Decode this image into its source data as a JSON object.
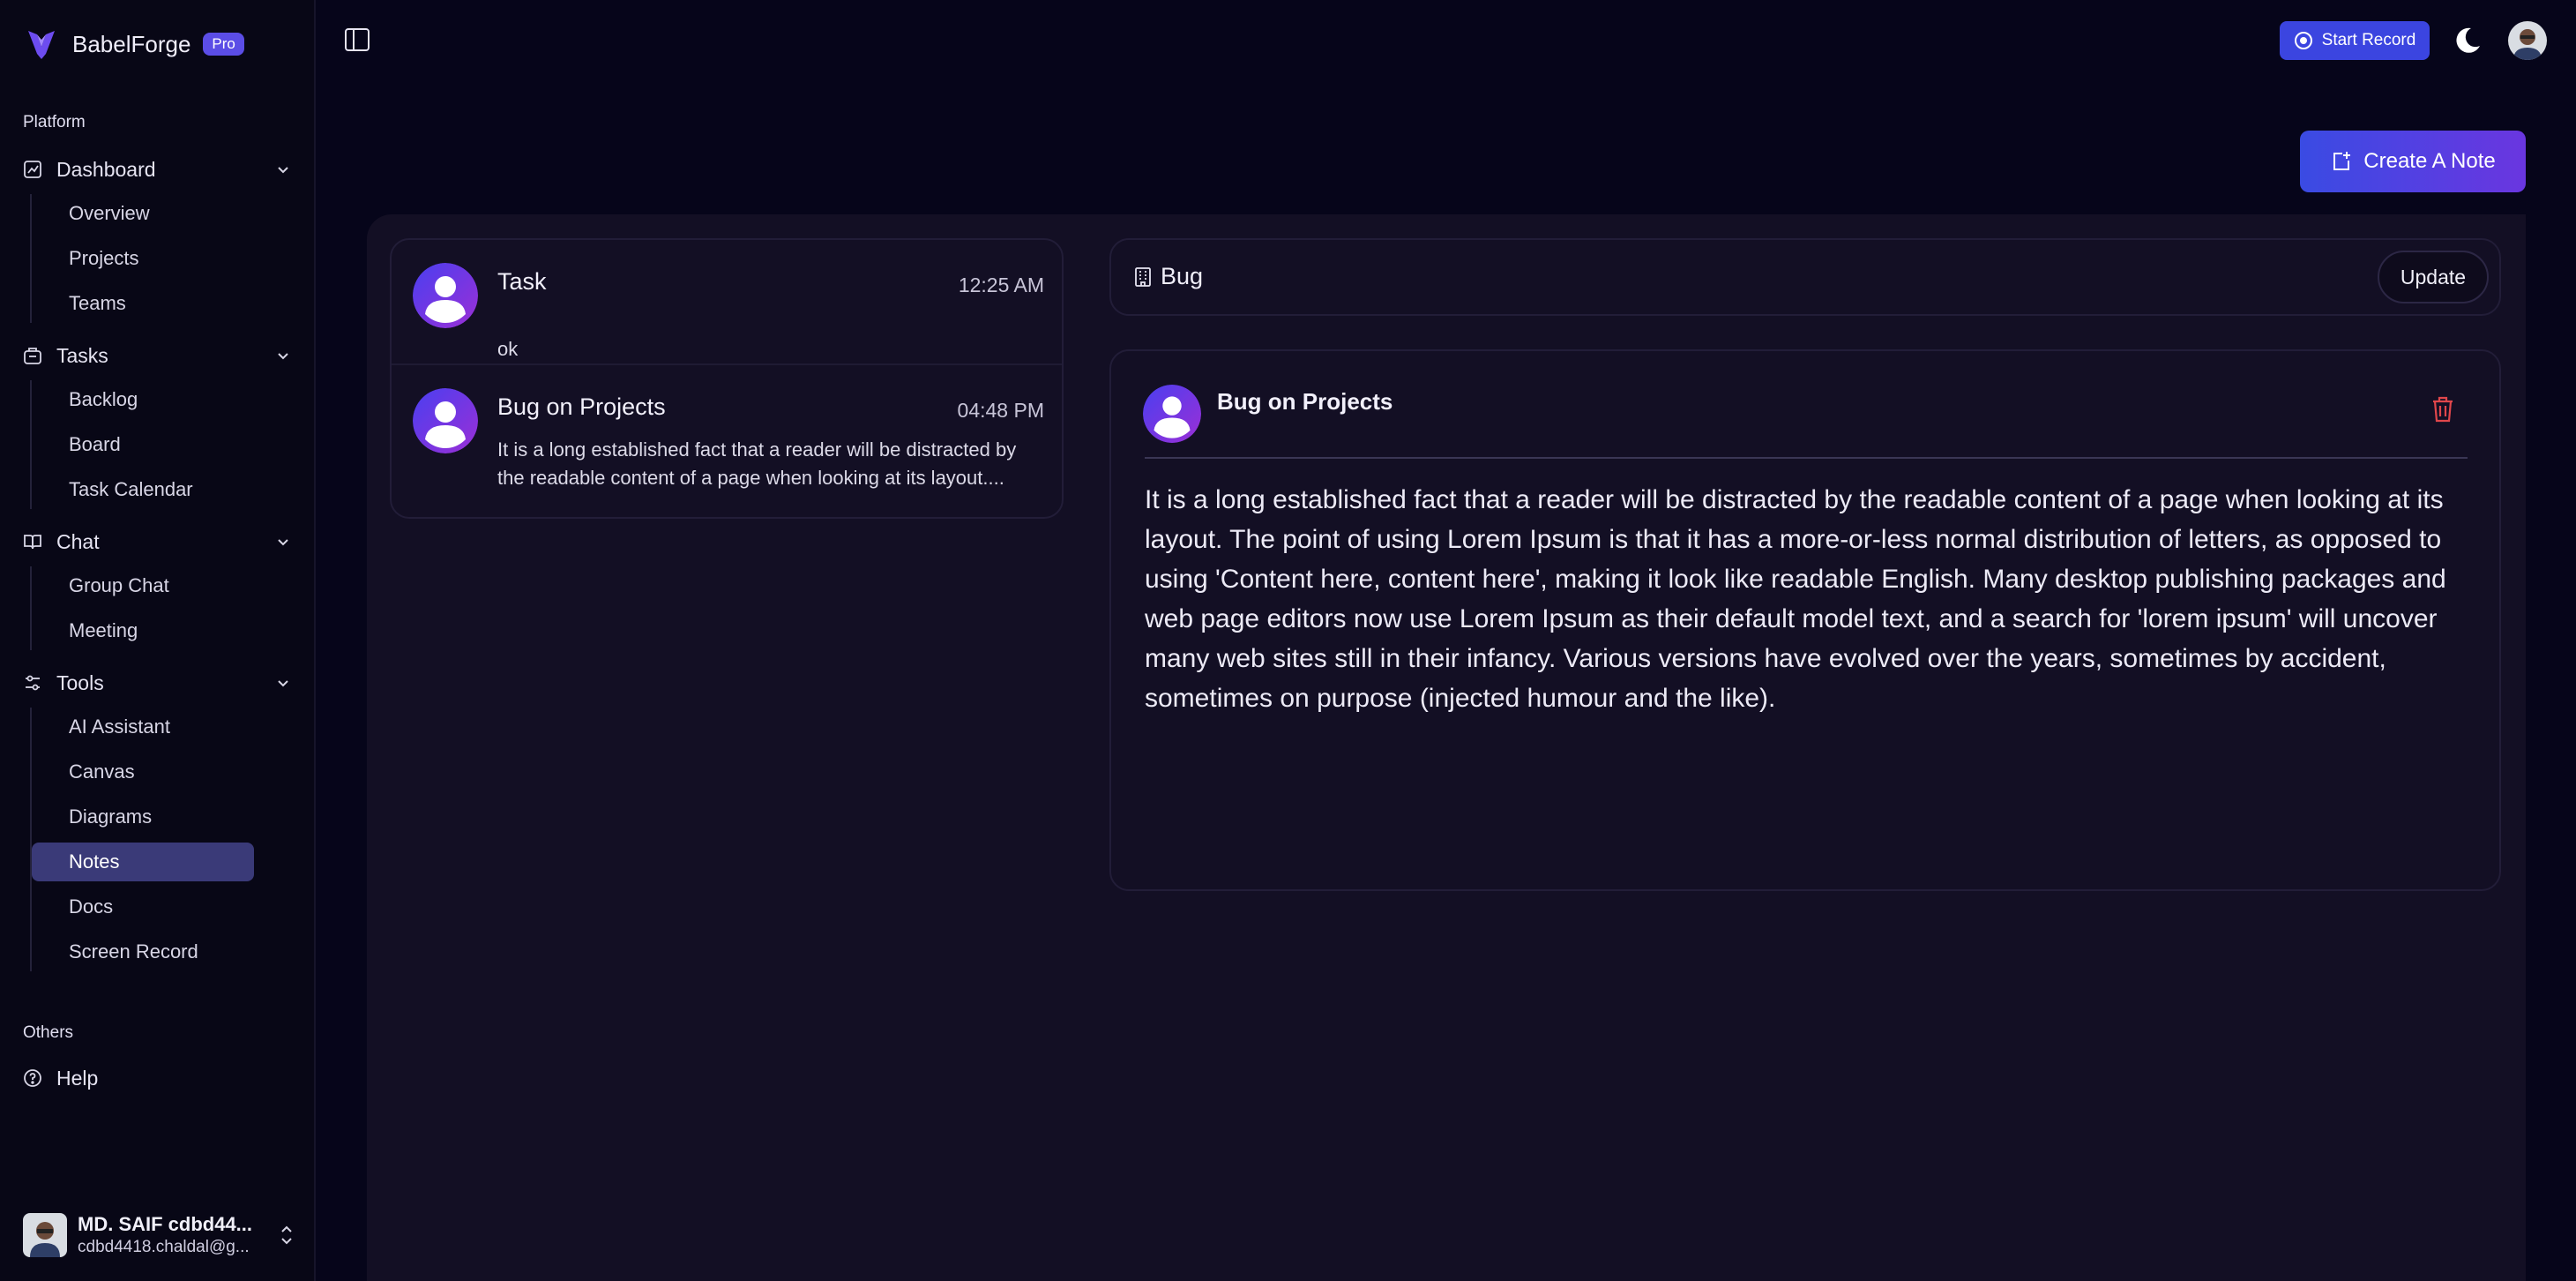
{
  "app": {
    "name": "BabelForge",
    "badge": "Pro"
  },
  "sidebar": {
    "platform_label": "Platform",
    "groups": [
      {
        "label": "Dashboard",
        "items": [
          "Overview",
          "Projects",
          "Teams"
        ]
      },
      {
        "label": "Tasks",
        "items": [
          "Backlog",
          "Board",
          "Task Calendar"
        ]
      },
      {
        "label": "Chat",
        "items": [
          "Group Chat",
          "Meeting"
        ]
      },
      {
        "label": "Tools",
        "items": [
          "AI Assistant",
          "Canvas",
          "Diagrams",
          "Notes",
          "Docs",
          "Screen Record"
        ]
      }
    ],
    "active_item": "Notes",
    "others_label": "Others",
    "help_label": "Help"
  },
  "user": {
    "name": "MD. SAIF cdbd44...",
    "email": "cdbd4418.chaldal@g..."
  },
  "topbar": {
    "record_label": "Start Record"
  },
  "actions": {
    "create_note_label": "Create A Note"
  },
  "notes": [
    {
      "title": "Task",
      "time": "12:25 AM",
      "preview": "ok"
    },
    {
      "title": "Bug on Projects",
      "time": "04:48 PM",
      "preview": "It is a long established fact that a reader will be distracted by the readable content of a page when looking at its layout...."
    }
  ],
  "detail": {
    "category": "Bug",
    "update_label": "Update",
    "title": "Bug on Projects",
    "content": "It is a long established fact that a reader will be distracted by the readable content of a page when looking at its layout. The point of using Lorem Ipsum is that it has a more-or-less normal distribution of letters, as opposed to using 'Content here, content here', making it look like readable English. Many desktop publishing packages and web page editors now use Lorem Ipsum as their default model text, and a search for 'lorem ipsum' will uncover many web sites still in their infancy. Various versions have evolved over the years, sometimes by accident, sometimes on purpose (injected humour and the like)."
  },
  "colors": {
    "accent": "#5b4de6",
    "active_nav": "#3a3a78",
    "record": "#3b45e0",
    "danger": "#e0464b"
  }
}
